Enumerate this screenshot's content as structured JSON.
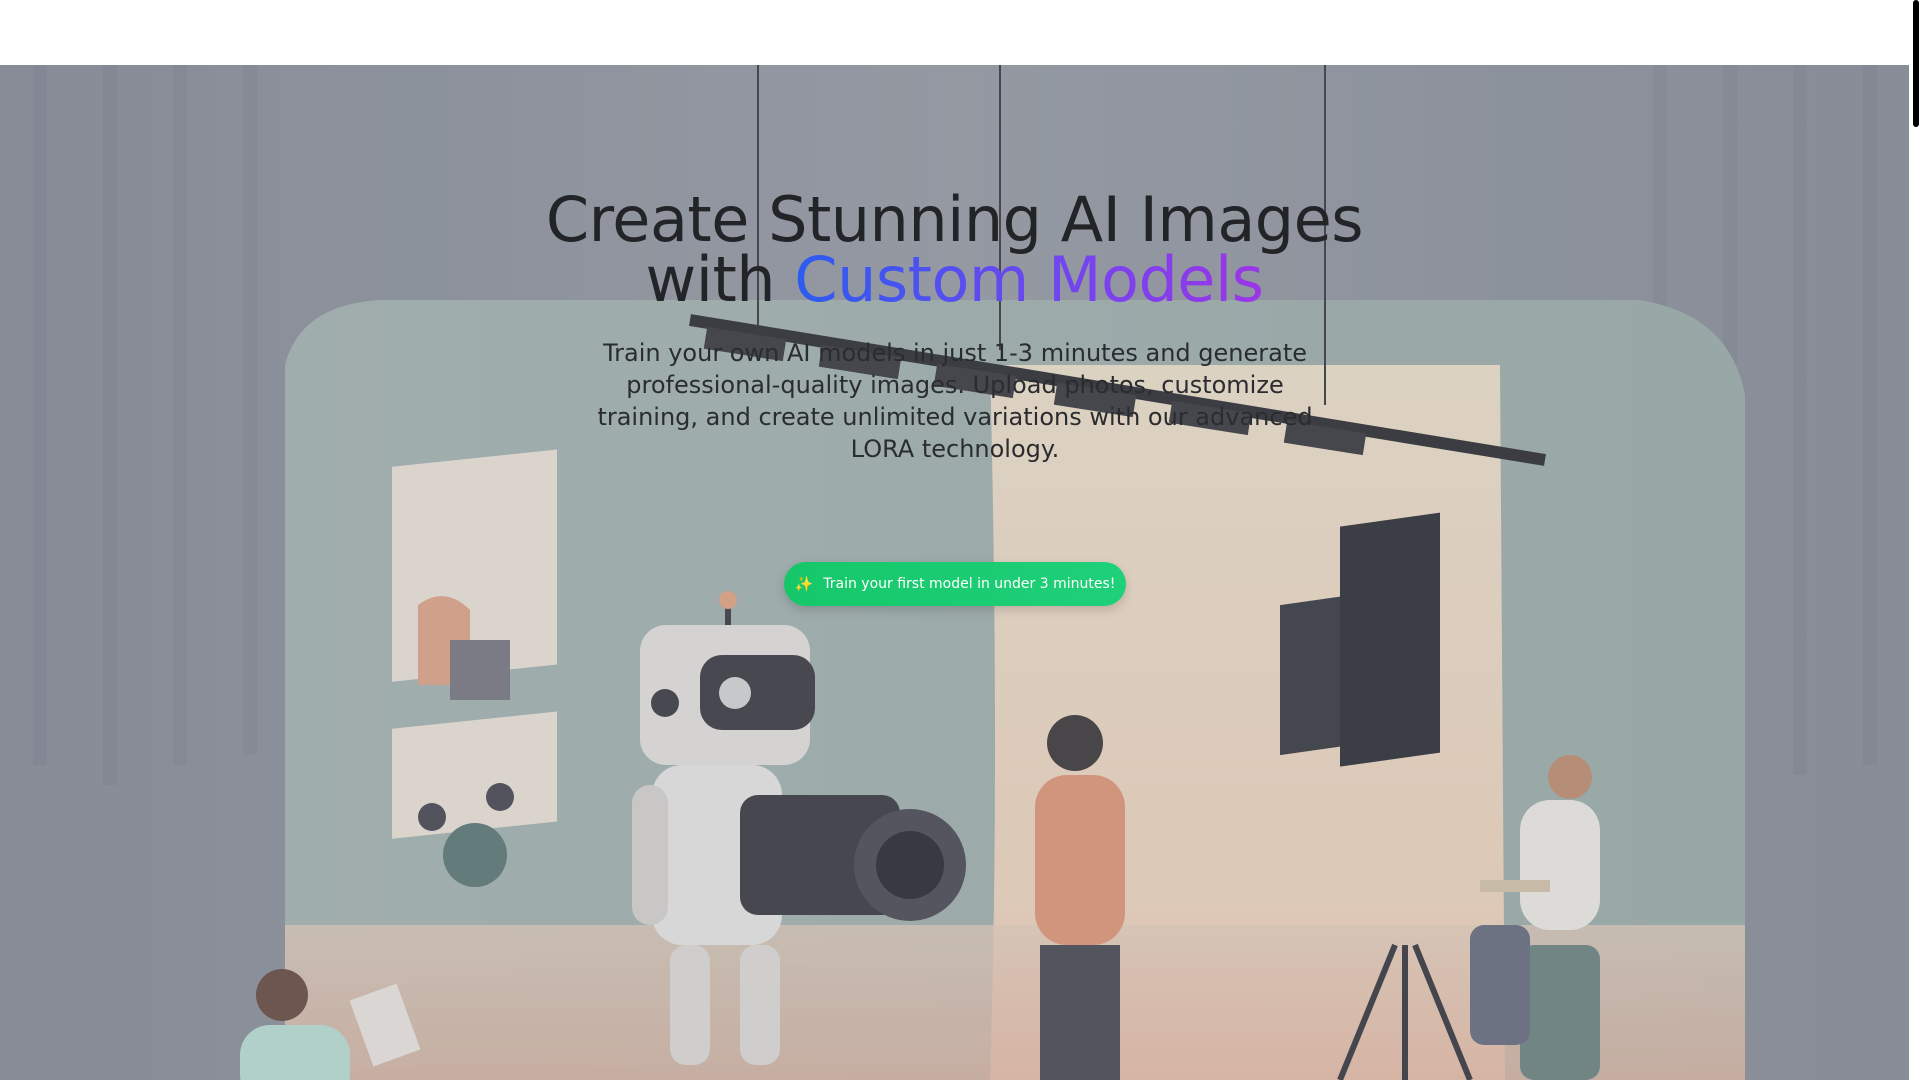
{
  "hero": {
    "headline_line1": "Create Stunning AI Images",
    "headline_with": "with ",
    "headline_highlight": "Custom Models",
    "subtext": "Train your own AI models in just 1-3 minutes and generate professional-quality images. Upload photos, customize training, and create unlimited variations with our advanced LORA technology.",
    "cta_icon": "✨",
    "cta_label": "Train your first model in under 3 minutes!",
    "background_illustration": "ai-photo-studio-illustration"
  },
  "colors": {
    "headline": "#222428",
    "highlight_start": "#2b5cf0",
    "highlight_end": "#9b35e8",
    "cta_background": "#1fd07a",
    "cta_text": "#ffffff"
  }
}
